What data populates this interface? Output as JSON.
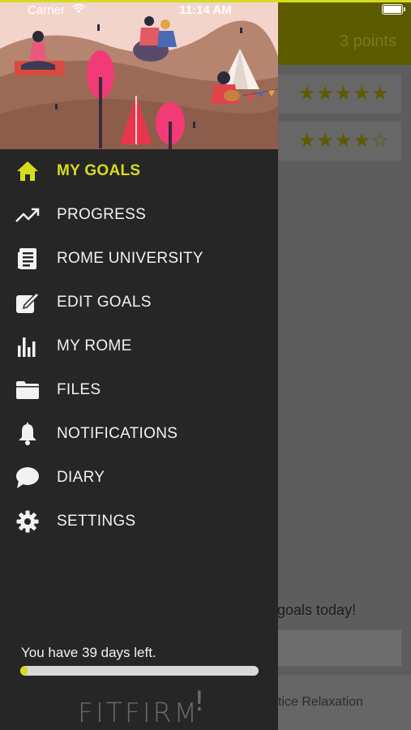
{
  "status_bar": {
    "carrier": "Carrier",
    "time": "11:14 AM"
  },
  "background": {
    "points": "3 points",
    "ratings": [
      "★★★★★",
      "★★★★☆"
    ],
    "goals_text": "goals today!",
    "bottom_text": "tice Relaxation"
  },
  "menu": {
    "items": [
      {
        "label": "MY GOALS",
        "icon": "home-icon",
        "active": true
      },
      {
        "label": "PROGRESS",
        "icon": "trending-up-icon"
      },
      {
        "label": "ROME UNIVERSITY",
        "icon": "article-icon"
      },
      {
        "label": "EDIT GOALS",
        "icon": "edit-icon"
      },
      {
        "label": "MY ROME",
        "icon": "bar-chart-icon"
      },
      {
        "label": "FILES",
        "icon": "folder-icon"
      },
      {
        "label": "NOTIFICATIONS",
        "icon": "bell-icon"
      },
      {
        "label": "DIARY",
        "icon": "chat-bubble-icon"
      },
      {
        "label": "SETTINGS",
        "icon": "gear-icon"
      }
    ]
  },
  "footer": {
    "days_left_text": "You have 39 days left.",
    "progress_fraction": 0.03,
    "logo_text": "FITFIRM",
    "logo_mark": "!"
  },
  "colors": {
    "accent": "#d7dc1e",
    "drawer_bg": "#262626",
    "text": "#f2f2f2"
  }
}
